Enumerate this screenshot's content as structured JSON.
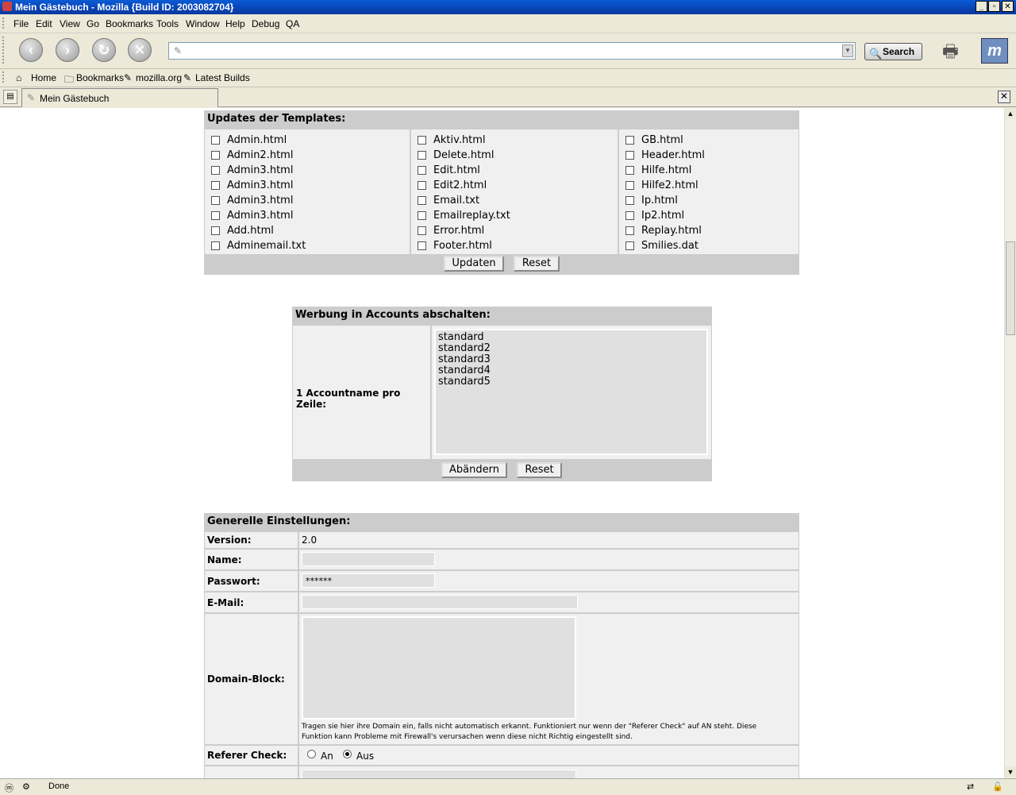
{
  "window": {
    "title": "Mein Gästebuch - Mozilla {Build ID: 2003082704}"
  },
  "menu": [
    "File",
    "Edit",
    "View",
    "Go",
    "Bookmarks",
    "Tools",
    "Window",
    "Help",
    "Debug",
    "QA"
  ],
  "toolbar": {
    "url_value": "",
    "search_label": "Search"
  },
  "personal_bar": [
    "Home",
    "Bookmarks",
    "mozilla.org",
    "Latest Builds"
  ],
  "tab": {
    "title": "Mein Gästebuch"
  },
  "templates": {
    "header": "Updates der Templates:",
    "col1": [
      "Admin.html",
      "Admin2.html",
      "Admin3.html",
      "Admin3.html",
      "Admin3.html",
      "Admin3.html",
      "Add.html",
      "Adminemail.txt"
    ],
    "col2": [
      "Aktiv.html",
      "Delete.html",
      "Edit.html",
      "Edit2.html",
      "Email.txt",
      "Emailreplay.txt",
      "Error.html",
      "Footer.html"
    ],
    "col3": [
      "GB.html",
      "Header.html",
      "Hilfe.html",
      "Hilfe2.html",
      "Ip.html",
      "Ip2.html",
      "Replay.html",
      "Smilies.dat"
    ],
    "update_label": "Updaten",
    "reset_label": "Reset"
  },
  "ads": {
    "header": "Werbung in Accounts abschalten:",
    "label": "1 Accountname pro Zeile:",
    "accounts": [
      "standard",
      "standard2",
      "standard3",
      "standard4",
      "standard5"
    ],
    "change_label": "Abändern",
    "reset_label": "Reset"
  },
  "general": {
    "header": "Generelle Einstellungen:",
    "version_label": "Version:",
    "version_value": "2.0",
    "name_label": "Name:",
    "name_value": "",
    "password_label": "Passwort:",
    "password_value": "******",
    "email_label": "E-Mail:",
    "email_value": "",
    "domain_label": "Domain-Block:",
    "domain_hint": "Tragen sie hier ihre Domain ein, falls nicht automatisch erkannt. Funktioniert nur wenn der \"Referer Check\" auf AN steht. Diese Funktion kann Probleme mit Firewall's verursachen wenn diese nicht Richtig eingestellt sind.",
    "referer_label": "Referer Check:",
    "referer_on": "An",
    "referer_off": "Aus"
  },
  "status": {
    "text": "Done"
  }
}
